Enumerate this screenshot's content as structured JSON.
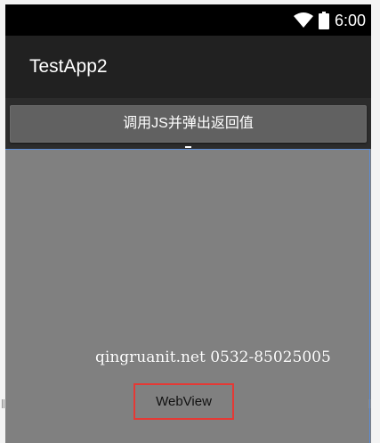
{
  "status_bar": {
    "time": "6:00",
    "icons": [
      "wifi-icon",
      "battery-icon"
    ]
  },
  "app_bar": {
    "title": "TestApp2"
  },
  "main": {
    "button_label": "调用JS并弹出返回值",
    "webview_label": "WebView"
  },
  "watermark": {
    "text": "qingruanit.net 0532-85025005"
  },
  "colors": {
    "status_bar": "#000000",
    "app_bar": "#212121",
    "button_strip": "#2c2c2c",
    "button": "#616161",
    "webview": "#808080",
    "selection_outline": "#5b8cd6",
    "label_box_border": "#e53935"
  }
}
